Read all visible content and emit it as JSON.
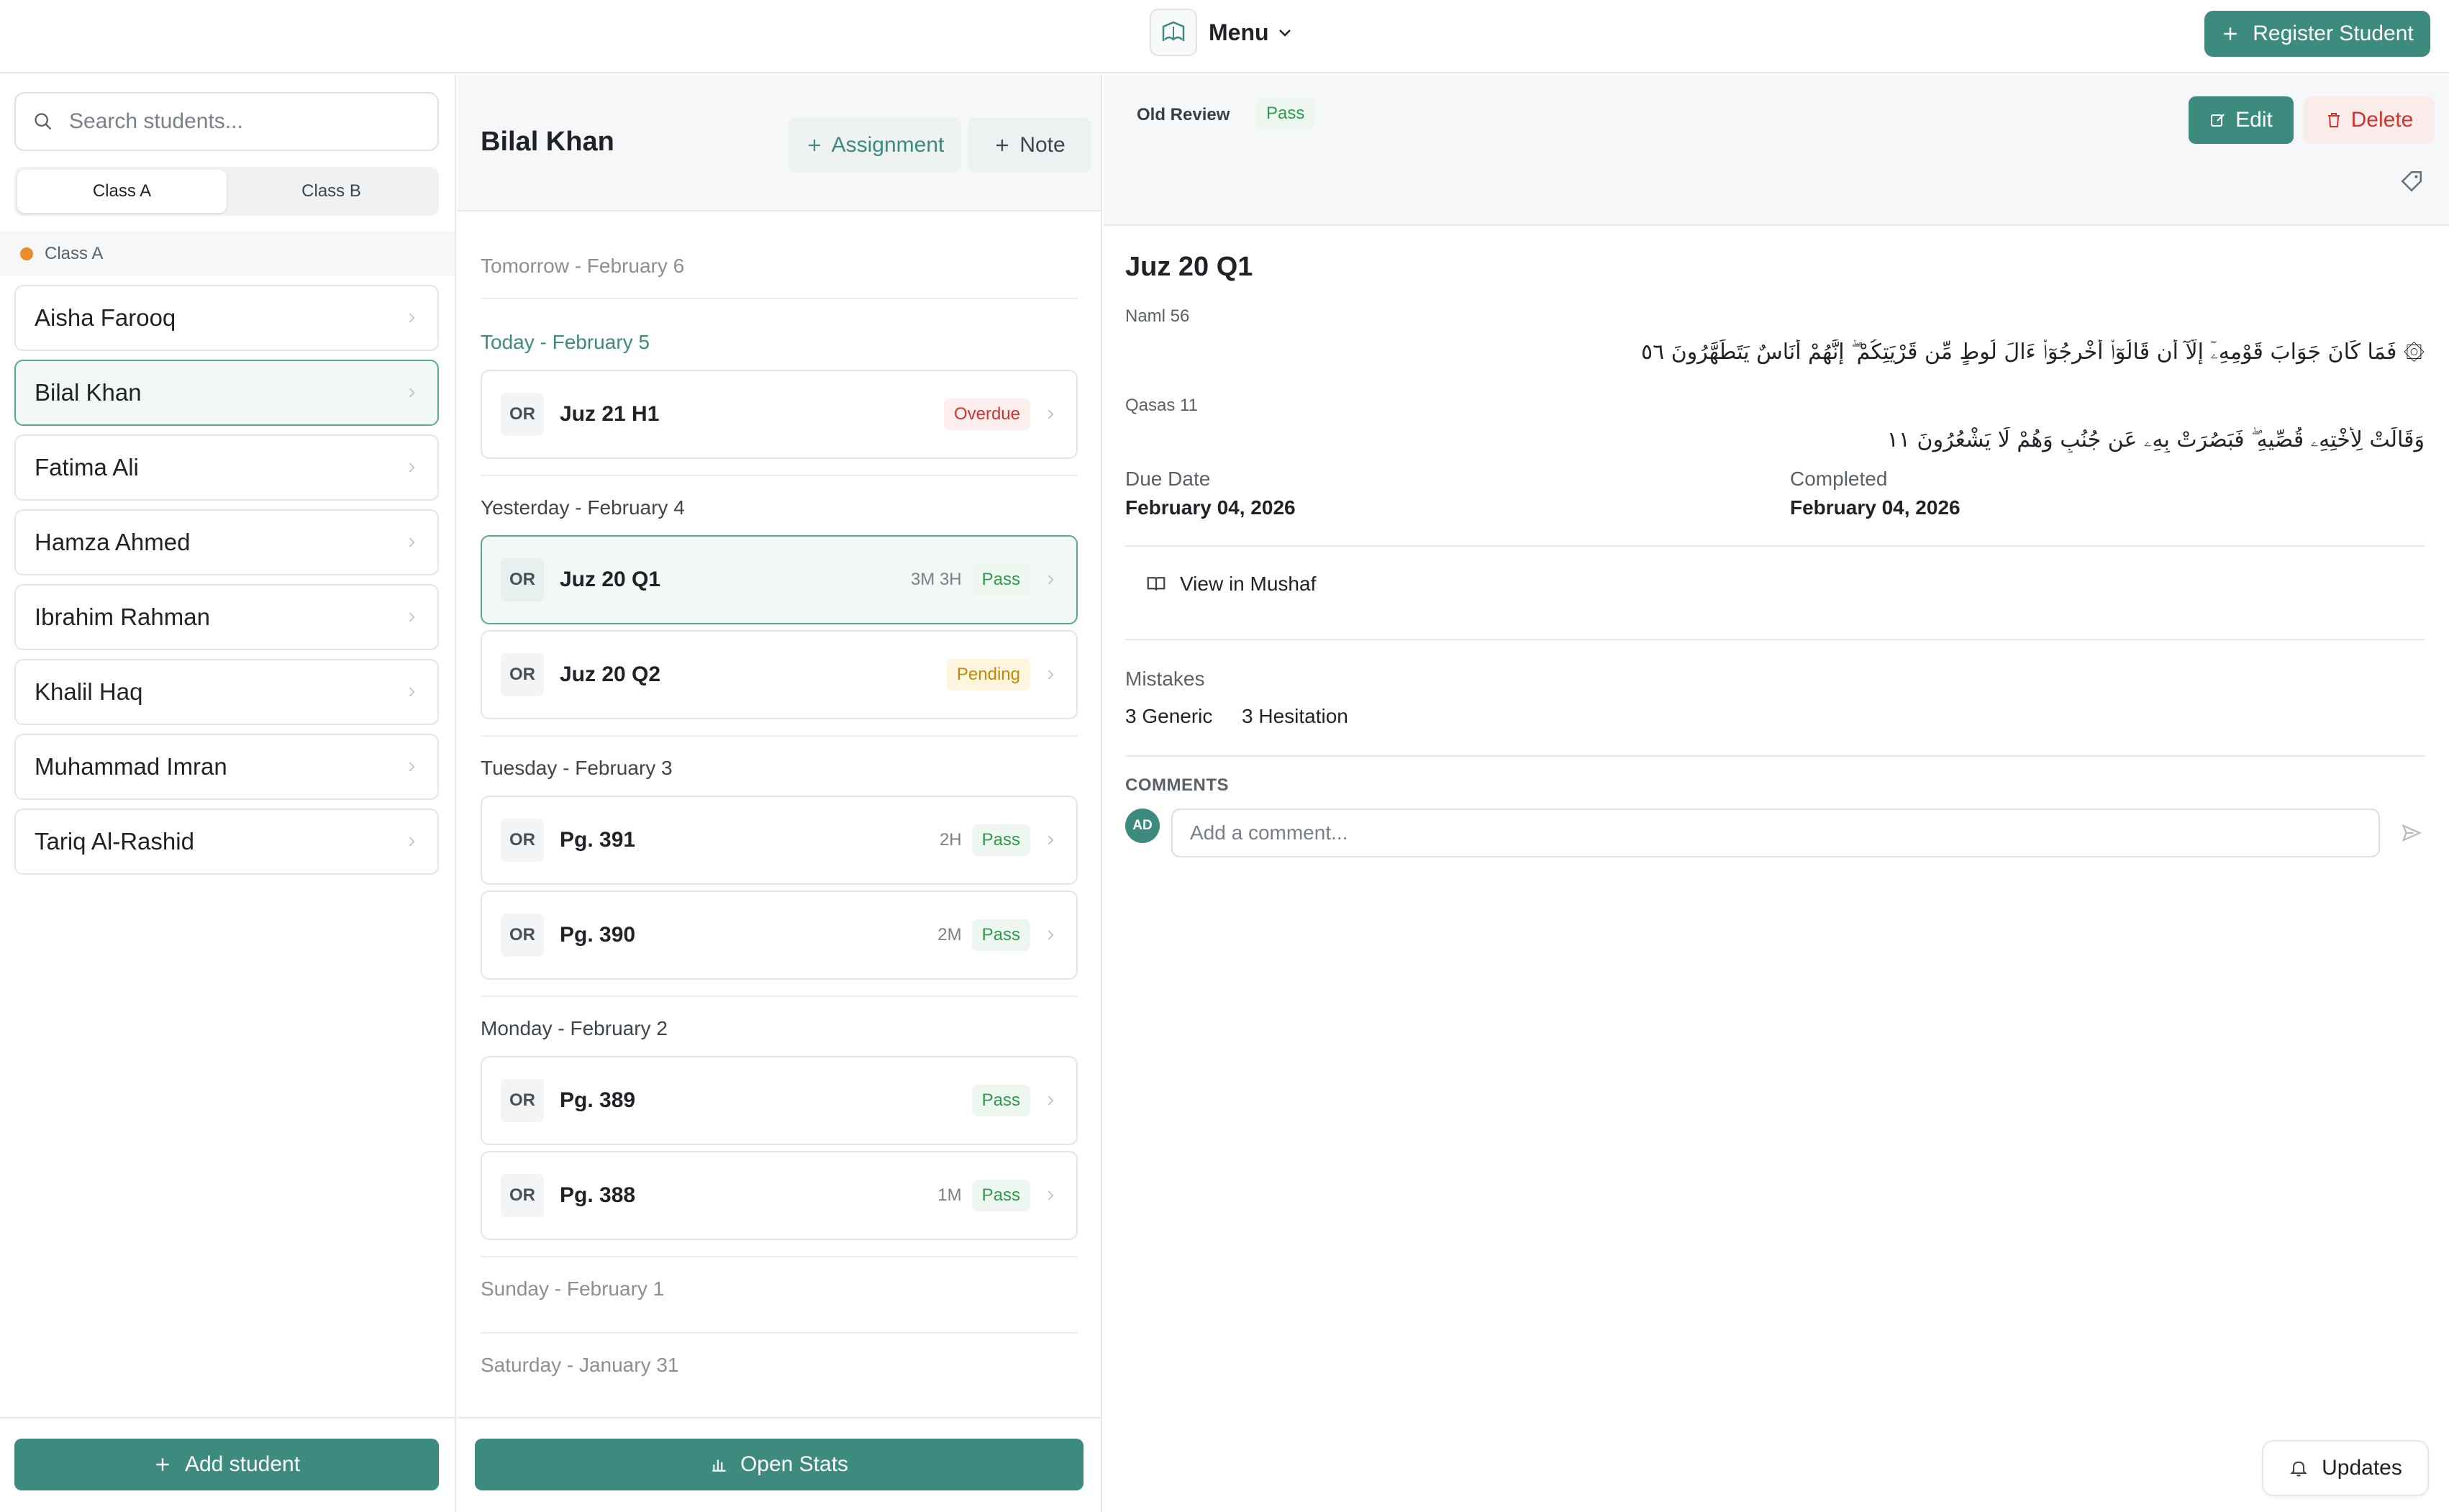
{
  "header": {
    "menu_label": "Menu",
    "register_label": "Register Student"
  },
  "sidebar": {
    "search_placeholder": "Search students...",
    "tabs": [
      "Class A",
      "Class B"
    ],
    "group_label": "Class A",
    "students": [
      "Aisha Farooq",
      "Bilal Khan",
      "Fatima Ali",
      "Hamza Ahmed",
      "Ibrahim Rahman",
      "Khalil Haq",
      "Muhammad Imran",
      "Tariq Al-Rashid"
    ],
    "add_label": "Add student"
  },
  "middle": {
    "student_name": "Bilal Khan",
    "assignment_label": "Assignment",
    "note_label": "Note",
    "days": [
      "Tomorrow - February 6",
      "Today - February 5",
      "Yesterday - February 4",
      "Tuesday - February 3",
      "Monday - February 2",
      "Sunday - February 1",
      "Saturday - January 31"
    ],
    "assignments": [
      {
        "code": "OR",
        "title": "Juz 21 H1",
        "meta": "",
        "status": "Overdue"
      },
      {
        "code": "OR",
        "title": "Juz 20 Q1",
        "meta": "3M 3H",
        "status": "Pass"
      },
      {
        "code": "OR",
        "title": "Juz 20 Q2",
        "meta": "",
        "status": "Pending"
      },
      {
        "code": "OR",
        "title": "Pg. 391",
        "meta": "2H",
        "status": "Pass"
      },
      {
        "code": "OR",
        "title": "Pg. 390",
        "meta": "2M",
        "status": "Pass"
      },
      {
        "code": "OR",
        "title": "Pg. 389",
        "meta": "",
        "status": "Pass"
      },
      {
        "code": "OR",
        "title": "Pg. 388",
        "meta": "1M",
        "status": "Pass"
      }
    ],
    "stats_label": "Open Stats"
  },
  "detail": {
    "type": "Old Review",
    "status": "Pass",
    "edit_label": "Edit",
    "delete_label": "Delete",
    "title": "Juz 20 Q1",
    "verse1_ref": "Naml 56",
    "verse1_text": "۞ فَمَا كَانَ جَوَابَ قَوْمِهِۦٓ إِلَّآ أَن قَالُوٓا۟ أَخْرِجُوٓا۟ ءَالَ لُوطٍ مِّن قَرْيَتِكُمْ ۖ إِنَّهُمْ أُنَاسٌ يَتَطَهَّرُونَ ٥٦",
    "verse2_ref": "Qasas 11",
    "verse2_text": "وَقَالَتْ لِأُخْتِهِۦ قُصِّيهِ ۖ فَبَصُرَتْ بِهِۦ عَن جُنُبٍ وَهُمْ لَا يَشْعُرُونَ ١١",
    "due_label": "Due Date",
    "due_value": "February 04, 2026",
    "completed_label": "Completed",
    "completed_value": "February 04, 2026",
    "mushaf_label": "View in Mushaf",
    "mistakes_label": "Mistakes",
    "mistake_generic": "3 Generic",
    "mistake_hesitation": "3 Hesitation",
    "comments_label": "COMMENTS",
    "avatar_initials": "AD",
    "comment_placeholder": "Add a comment...",
    "updates_label": "Updates"
  },
  "colors": {
    "accent": "#3d8a7f",
    "pass": "#2e9a4e",
    "overdue": "#d0342c",
    "pending": "#c08a0a",
    "class_dot": "#ee8a2e"
  }
}
